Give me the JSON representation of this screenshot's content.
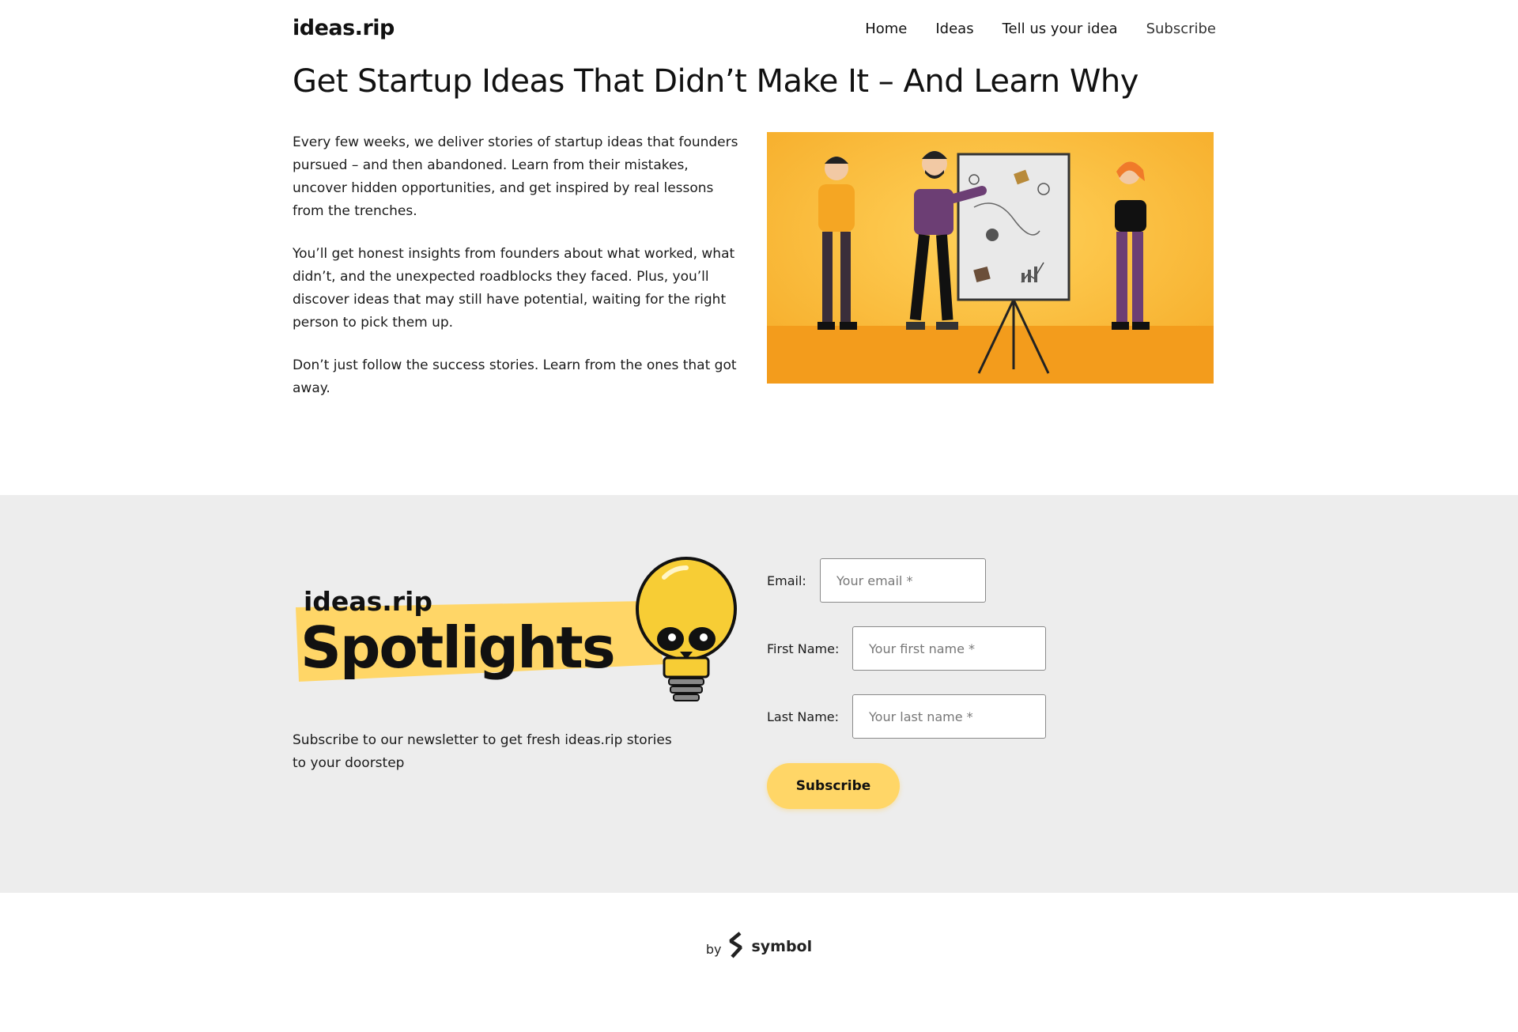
{
  "header": {
    "logo": "ideas.rip",
    "nav": [
      {
        "label": "Home"
      },
      {
        "label": "Ideas"
      },
      {
        "label": "Tell us your idea"
      },
      {
        "label": "Subscribe"
      }
    ]
  },
  "hero": {
    "headline": "Get Startup Ideas That Didn’t Make It – And Learn Why",
    "paragraphs": [
      "Every few weeks, we deliver stories of startup ideas that founders pursued – and then abandoned. Learn from their mistakes, uncover hidden opportunities, and get inspired by real lessons from the trenches.",
      "You’ll get honest insights from founders about what worked, what didn’t, and the unexpected roadblocks they faced. Plus, you’ll discover ideas that may still have potential, waiting for the right person to pick them up.",
      "Don’t just follow the success stories. Learn from the ones that got away."
    ]
  },
  "newsletter": {
    "badge_top": "ideas.rip",
    "badge_main": "Spotlights",
    "description": "Subscribe to our newsletter to get fresh ideas.rip stories to your doorstep",
    "email_label": "Email:",
    "email_placeholder": "Your email *",
    "first_name_label": "First Name:",
    "first_name_placeholder": "Your first name *",
    "last_name_label": "Last Name:",
    "last_name_placeholder": "Your last name *",
    "subscribe_label": "Subscribe"
  },
  "footer": {
    "by": "by",
    "brand": "symbol"
  },
  "colors": {
    "accent": "#ffd667",
    "band_background": "#ededed",
    "hero_background": "#f8b630"
  }
}
